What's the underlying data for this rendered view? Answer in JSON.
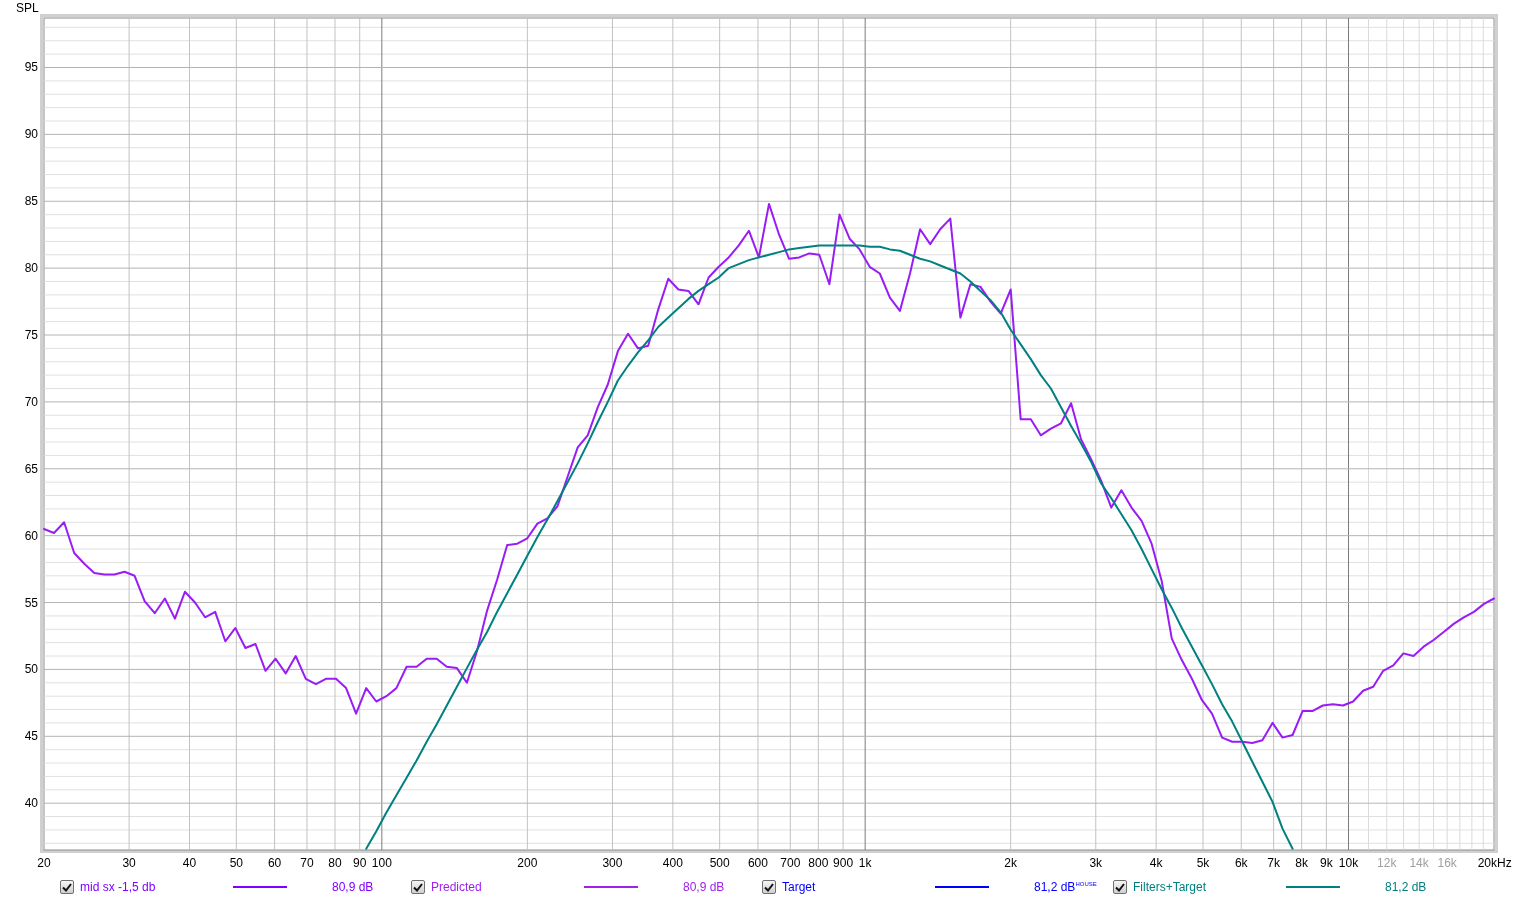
{
  "chart": {
    "chart_data": {
      "type": "line",
      "log": "x",
      "grid": true,
      "xlabel": "Hz",
      "ylabel": "SPL",
      "xlim": [
        20,
        20000
      ],
      "ylim": [
        36.5,
        98.7
      ],
      "xticks": [
        {
          "value": 20,
          "label": "20"
        },
        {
          "value": 30,
          "label": "30"
        },
        {
          "value": 40,
          "label": "40"
        },
        {
          "value": 50,
          "label": "50"
        },
        {
          "value": 60,
          "label": "60"
        },
        {
          "value": 70,
          "label": "70"
        },
        {
          "value": 80,
          "label": "80"
        },
        {
          "value": 90,
          "label": "90"
        },
        {
          "value": 100,
          "label": "100"
        },
        {
          "value": 200,
          "label": "200"
        },
        {
          "value": 300,
          "label": "300"
        },
        {
          "value": 400,
          "label": "400"
        },
        {
          "value": 500,
          "label": "500"
        },
        {
          "value": 600,
          "label": "600"
        },
        {
          "value": 700,
          "label": "700"
        },
        {
          "value": 800,
          "label": "800"
        },
        {
          "value": 900,
          "label": "900"
        },
        {
          "value": 1000,
          "label": "1k"
        },
        {
          "value": 2000,
          "label": "2k"
        },
        {
          "value": 3000,
          "label": "3k"
        },
        {
          "value": 4000,
          "label": "4k"
        },
        {
          "value": 5000,
          "label": "5k"
        },
        {
          "value": 6000,
          "label": "6k"
        },
        {
          "value": 7000,
          "label": "7k"
        },
        {
          "value": 8000,
          "label": "8k"
        },
        {
          "value": 9000,
          "label": "9k"
        },
        {
          "value": 10000,
          "label": "10k"
        },
        {
          "value": 12000,
          "label": "12k"
        },
        {
          "value": 14000,
          "label": "14k"
        },
        {
          "value": 16000,
          "label": "16k"
        },
        {
          "value": 20000,
          "label": "20k"
        }
      ],
      "yticks": [
        40,
        45,
        50,
        55,
        60,
        65,
        70,
        75,
        80,
        85,
        90,
        95
      ],
      "x": [
        20,
        20.98,
        22.01,
        23.09,
        24.23,
        25.42,
        26.67,
        27.98,
        29.35,
        30.79,
        32.3,
        33.89,
        35.57,
        37.31,
        39.14,
        41.07,
        43.09,
        45.2,
        47.43,
        49.76,
        52.2,
        54.77,
        57.46,
        60.28,
        63.25,
        66.35,
        69.61,
        73.03,
        76.62,
        80.38,
        84.34,
        88.48,
        92.83,
        97.39,
        102.2,
        107.2,
        112.5,
        118,
        123.8,
        129.9,
        136.3,
        143,
        150,
        157.4,
        165.1,
        173.2,
        181.7,
        190.7,
        200,
        209.8,
        220.1,
        230.9,
        242.3,
        254.2,
        266.7,
        279.8,
        293.5,
        307.9,
        323,
        338.9,
        355.7,
        373.1,
        391.4,
        410.7,
        430.9,
        452,
        474.3,
        497.6,
        522,
        547.7,
        574.6,
        602.8,
        632.5,
        663.5,
        696.1,
        730.3,
        766.2,
        803.8,
        843.4,
        884.8,
        928.3,
        973.9,
        1022,
        1072,
        1125,
        1180,
        1238,
        1299,
        1363,
        1430,
        1500,
        1574,
        1651,
        1732,
        1817,
        1907,
        2000,
        2098,
        2201,
        2309,
        2423,
        2542,
        2667,
        2798,
        2935,
        3079,
        3230,
        3389,
        3557,
        3731,
        3914,
        4107,
        4309,
        4520,
        4743,
        4976,
        5220,
        5477,
        5746,
        6028,
        6325,
        6635,
        6961,
        7303,
        7662,
        8038,
        8434,
        8848,
        9283,
        9739,
        10220,
        10720,
        11250,
        11800,
        12380,
        12990,
        13630,
        14300,
        15000,
        15740,
        16510,
        17320,
        18170,
        19070,
        20000
      ],
      "series": [
        {
          "color": "#9a1cf5",
          "values": [
            60.5,
            60.2,
            61.0,
            58.7,
            57.9,
            57.2,
            57.1,
            57.1,
            57.3,
            57.0,
            55.1,
            54.2,
            55.3,
            53.8,
            55.8,
            55.0,
            53.9,
            54.3,
            52.1,
            53.1,
            51.6,
            51.9,
            49.9,
            50.8,
            49.7,
            51.0,
            49.3,
            48.9,
            49.3,
            49.3,
            48.6,
            46.7,
            48.6,
            47.6,
            48.0,
            48.6,
            50.2,
            50.2,
            50.8,
            50.8,
            50.2,
            50.1,
            49.0,
            51.4,
            54.4,
            56.7,
            59.3,
            59.4,
            59.8,
            60.9,
            61.3,
            62.2,
            64.4,
            66.6,
            67.5,
            69.6,
            71.3,
            73.8,
            75.1,
            74.0,
            74.2,
            76.9,
            79.2,
            78.4,
            78.3,
            77.3,
            79.3,
            80.1,
            80.8,
            81.7,
            82.8,
            80.8,
            84.8,
            82.5,
            80.7,
            80.8,
            81.1,
            81.0,
            78.8,
            84.0,
            82.2,
            81.4,
            80.1,
            79.6,
            77.8,
            76.8,
            79.6,
            82.9,
            81.8,
            82.9,
            83.7,
            76.3,
            78.8,
            78.6,
            77.5,
            76.6,
            78.4,
            68.7,
            68.7,
            67.5,
            68.0,
            68.4,
            69.9,
            67.2,
            65.7,
            64.1,
            62.1,
            63.4,
            62.1,
            61.1,
            59.4,
            56.6,
            52.3,
            50.7,
            49.3,
            47.7,
            46.7,
            44.9,
            44.6,
            44.6,
            44.5,
            44.7,
            46.0,
            44.9,
            45.1,
            46.9,
            46.9,
            47.3,
            47.4,
            47.3,
            47.6,
            48.4,
            48.7,
            49.9,
            50.3,
            51.2,
            51.0,
            51.7,
            52.2,
            52.8,
            53.4,
            53.9,
            54.3,
            54.9,
            55.3
          ]
        },
        {
          "color": "#008080",
          "values": [
            null,
            null,
            null,
            null,
            null,
            null,
            null,
            null,
            null,
            null,
            null,
            null,
            null,
            null,
            null,
            null,
            null,
            null,
            null,
            null,
            null,
            null,
            null,
            null,
            null,
            null,
            null,
            null,
            null,
            null,
            null,
            null,
            36.6,
            37.9,
            39.3,
            40.6,
            41.9,
            43.2,
            44.6,
            45.9,
            47.3,
            48.7,
            50.1,
            51.5,
            52.8,
            54.3,
            55.7,
            57.1,
            58.5,
            59.9,
            61.2,
            62.6,
            64.0,
            65.4,
            66.9,
            68.5,
            70.0,
            71.6,
            72.7,
            73.7,
            74.6,
            75.6,
            76.3,
            77.0,
            77.7,
            78.3,
            78.8,
            79.3,
            80.0,
            80.3,
            80.6,
            80.8,
            81.0,
            81.2,
            81.4,
            81.5,
            81.6,
            81.7,
            81.7,
            81.7,
            81.7,
            81.7,
            81.6,
            81.6,
            81.4,
            81.3,
            81.0,
            80.7,
            80.5,
            80.2,
            79.9,
            79.6,
            79.0,
            78.3,
            77.6,
            76.7,
            75.4,
            74.3,
            73.2,
            72.0,
            71.0,
            69.6,
            68.2,
            66.9,
            65.5,
            63.9,
            62.8,
            61.6,
            60.4,
            59.0,
            57.5,
            56.0,
            54.6,
            53.1,
            51.7,
            50.3,
            48.9,
            47.4,
            46.1,
            44.6,
            43.1,
            41.6,
            40.1,
            38.1,
            36.6,
            null,
            null,
            null,
            null,
            null,
            null,
            null,
            null,
            null,
            null,
            null,
            null,
            null,
            null,
            null,
            null,
            null,
            null,
            null,
            null
          ]
        }
      ]
    }
  },
  "legend": [
    {
      "label": "mid sx -1,5 db",
      "checked": true,
      "color": "#8000ff",
      "value": "80,9 dB"
    },
    {
      "label": "Predicted",
      "checked": true,
      "color": "#a020f0",
      "value": "80,9 dB"
    },
    {
      "label": "Target",
      "checked": true,
      "color": "#0000ff",
      "value": "81,2 dB$^{HOUSE}$"
    },
    {
      "label": "Filters+Target",
      "checked": true,
      "color": "#008080",
      "value": "81,2 dB"
    }
  ]
}
